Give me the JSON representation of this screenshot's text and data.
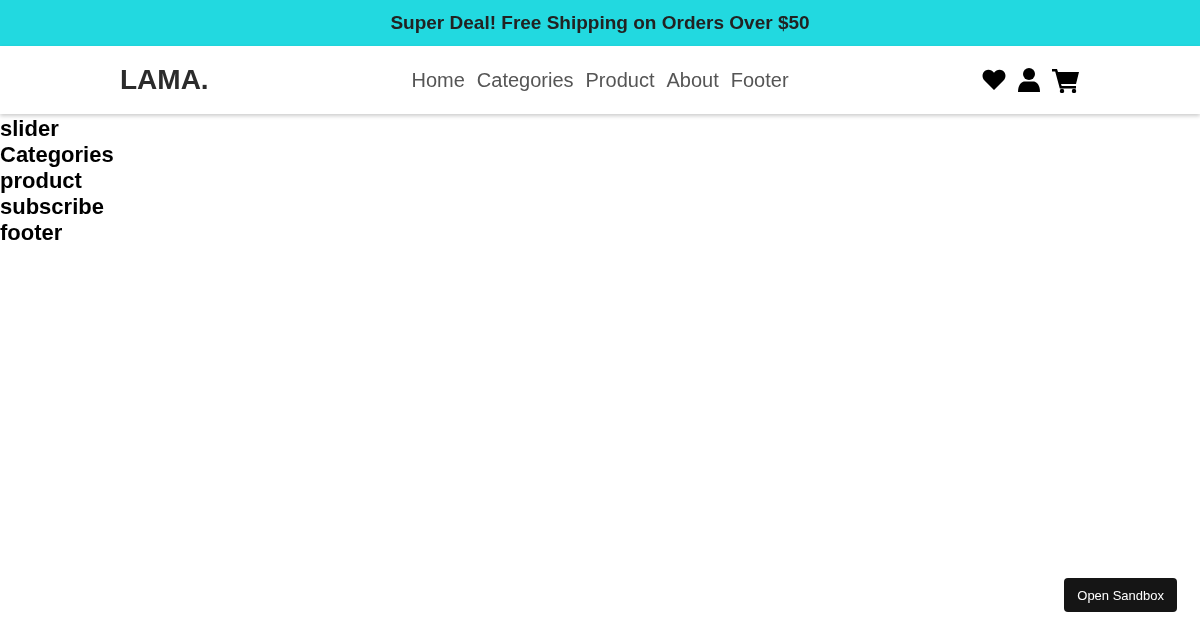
{
  "announcement": "Super Deal! Free Shipping on Orders Over $50",
  "logo": "LAMA.",
  "nav_links": [
    "Home",
    "Categories",
    "Product",
    "About",
    "Footer"
  ],
  "header_icons": [
    {
      "kind": "heart"
    },
    {
      "kind": "user"
    },
    {
      "kind": "cart"
    }
  ],
  "sections": [
    "slider",
    "Categories",
    "product",
    "subscribe",
    "footer"
  ],
  "sandbox_button": "Open Sandbox"
}
